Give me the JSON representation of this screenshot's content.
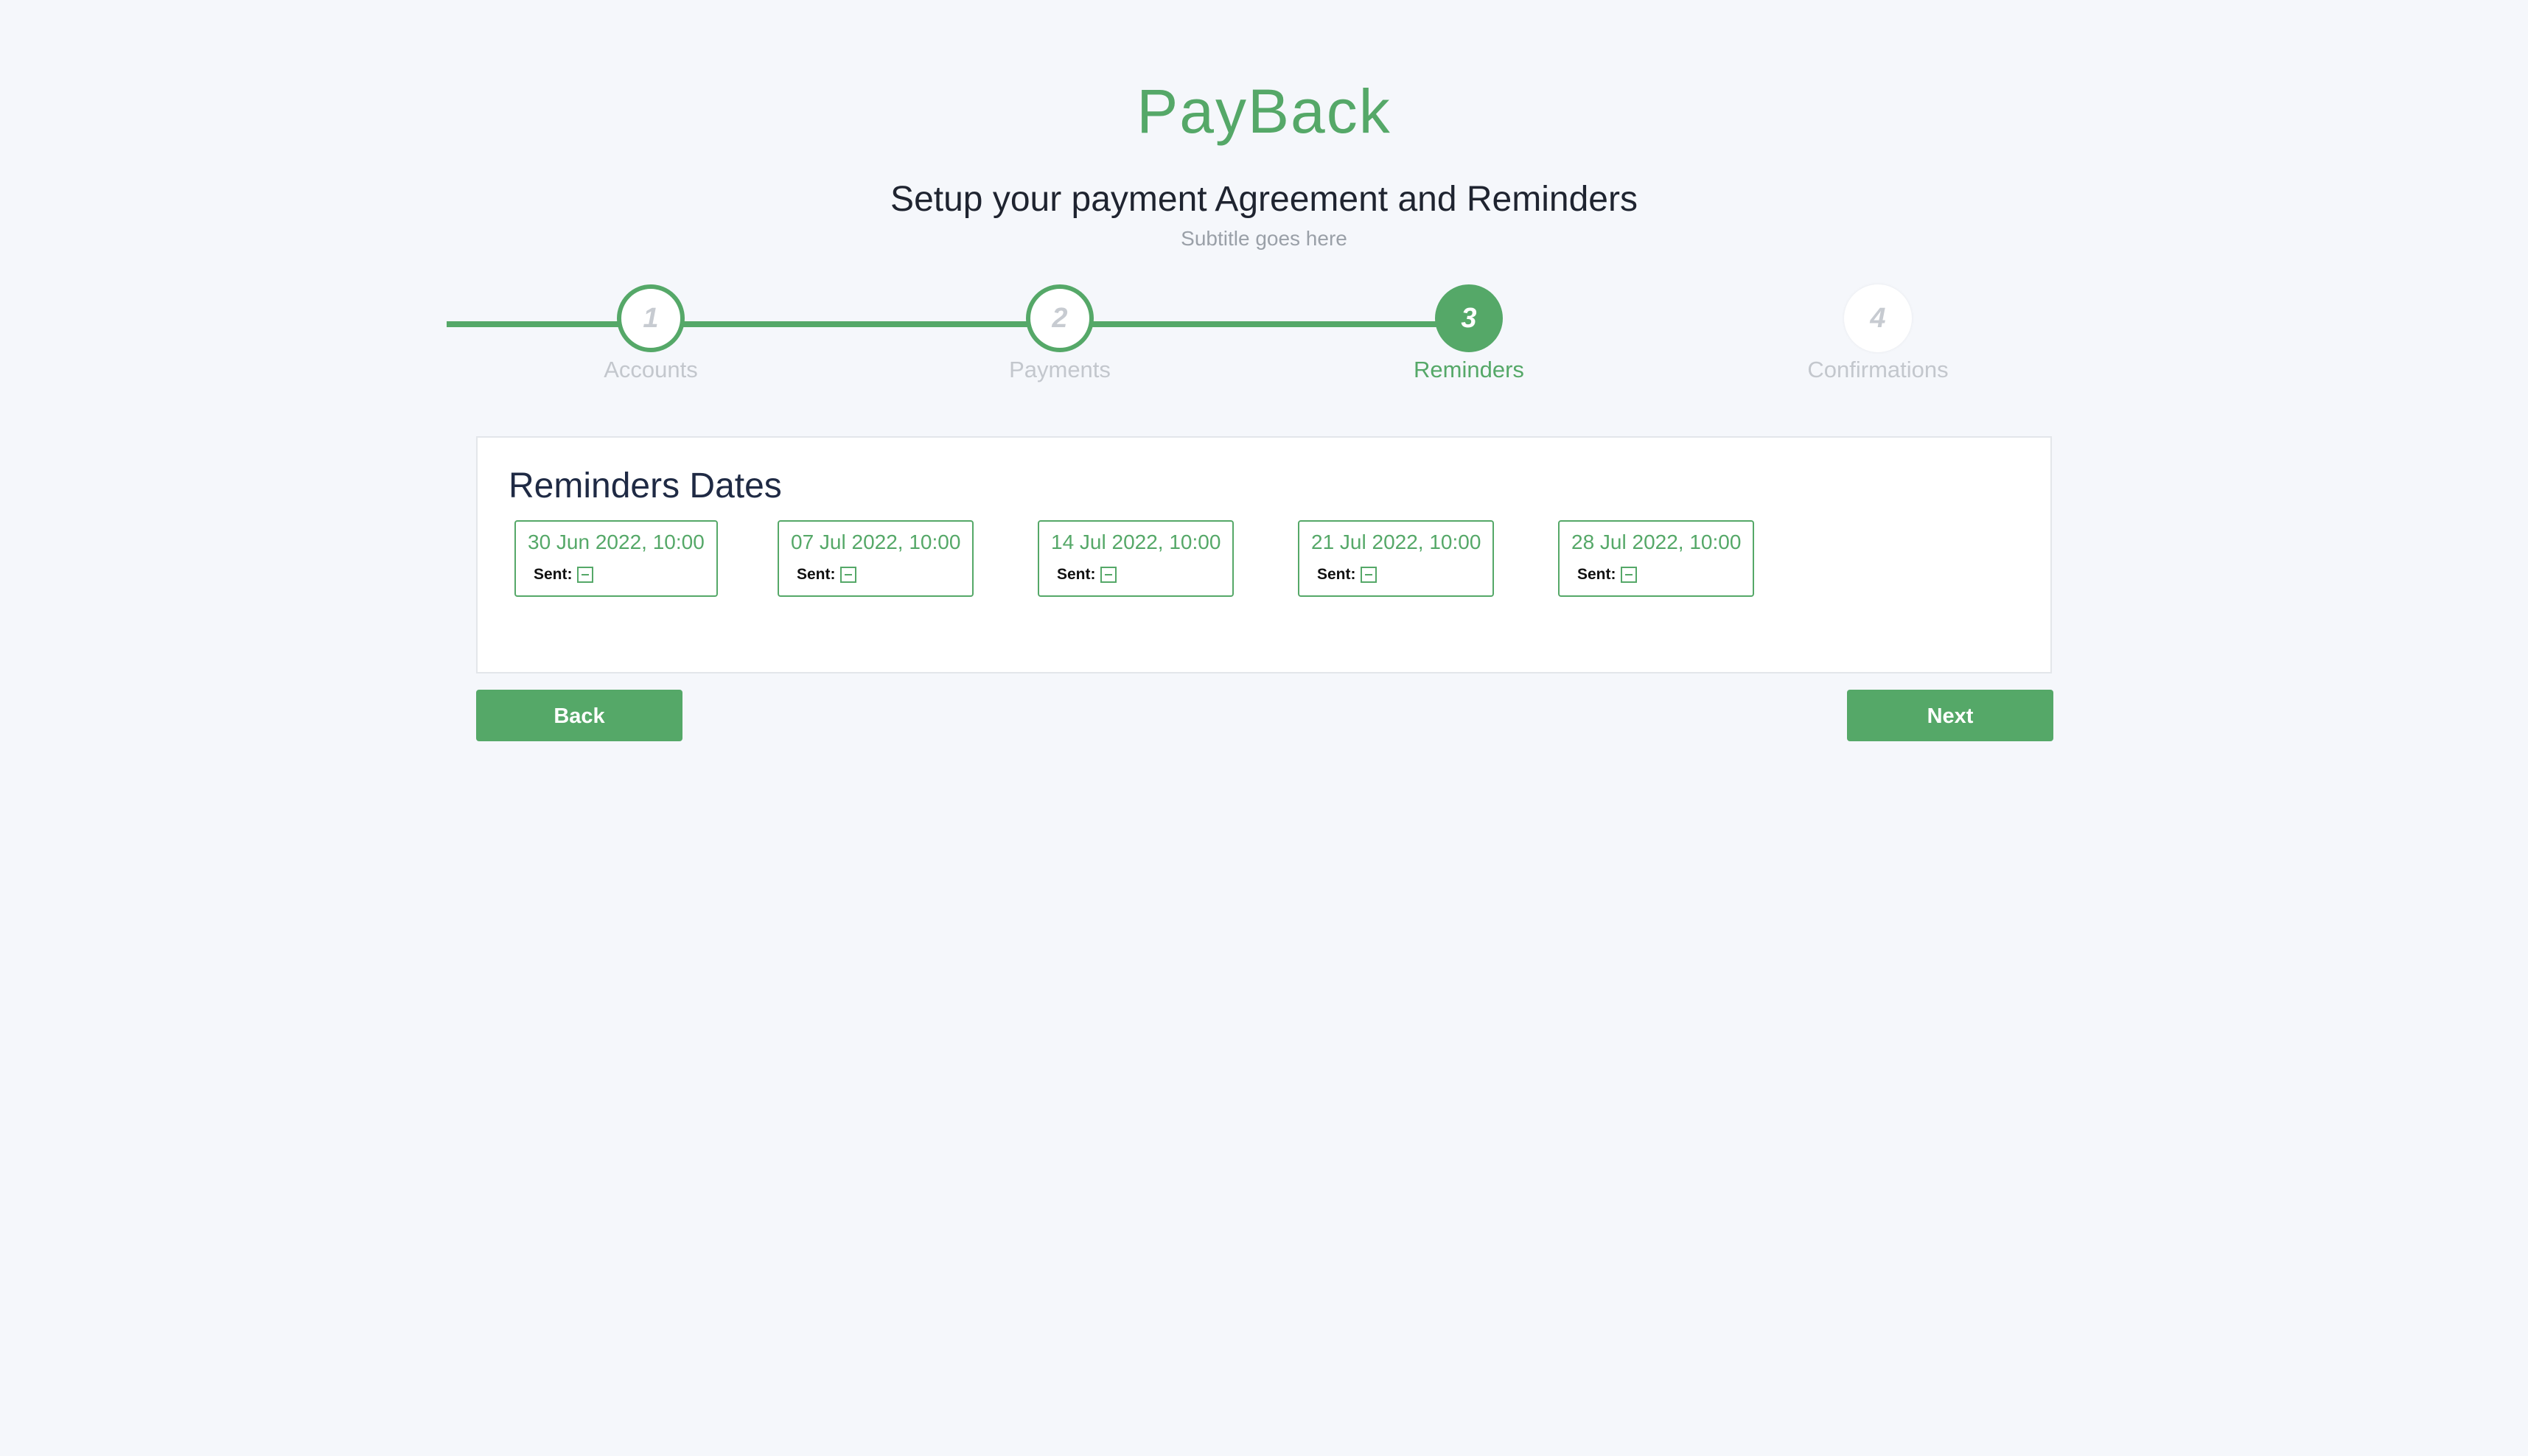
{
  "app": {
    "brand": "PayBack",
    "headline": "Setup your payment Agreement and Reminders",
    "subtitle": "Subtitle goes here"
  },
  "stepper": {
    "current_step": 3,
    "steps": [
      {
        "number": "1",
        "label": "Accounts",
        "state": "done"
      },
      {
        "number": "2",
        "label": "Payments",
        "state": "done"
      },
      {
        "number": "3",
        "label": "Reminders",
        "state": "active"
      },
      {
        "number": "4",
        "label": "Confirmations",
        "state": "todo"
      }
    ]
  },
  "reminders": {
    "title": "Reminders Dates",
    "sent_label": "Sent:",
    "items": [
      {
        "date": "30 Jun 2022, 10:00",
        "sent": "indeterminate"
      },
      {
        "date": "07 Jul 2022, 10:00",
        "sent": "indeterminate"
      },
      {
        "date": "14 Jul 2022, 10:00",
        "sent": "indeterminate"
      },
      {
        "date": "21 Jul 2022, 10:00",
        "sent": "indeterminate"
      },
      {
        "date": "28 Jul 2022, 10:00",
        "sent": "indeterminate"
      }
    ]
  },
  "actions": {
    "back_label": "Back",
    "next_label": "Next"
  },
  "colors": {
    "accent": "#55a868",
    "background": "#f5f7fb",
    "heading": "#1f2a44",
    "muted": "#c3c7cd"
  }
}
